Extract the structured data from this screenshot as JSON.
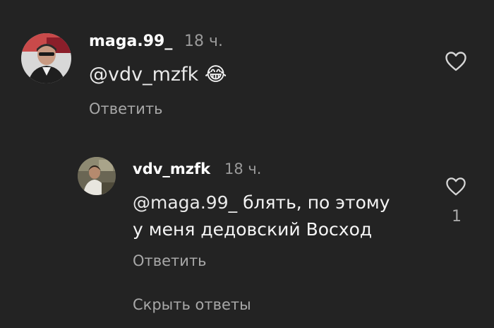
{
  "comments": [
    {
      "username": "maga.99_",
      "time": "18 ч.",
      "mention": "@vdv_mzfk",
      "emoji": "😂",
      "reply_label": "Ответить"
    }
  ],
  "replies": [
    {
      "username": "vdv_mzfk",
      "time": "18 ч.",
      "mention": "@maga.99_",
      "text_line1": "блять, по этому",
      "text_line2": "у меня дедовский Восход",
      "reply_label": "Ответить",
      "like_count": "1"
    }
  ],
  "hide_replies_label": "Скрыть ответы",
  "icons": {
    "like": "heart-outline-icon"
  }
}
